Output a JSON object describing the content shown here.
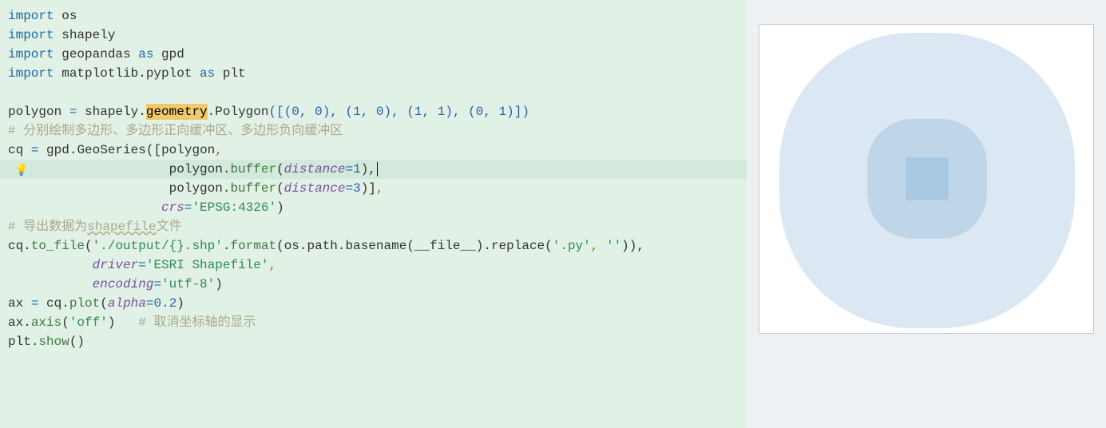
{
  "code": {
    "l1_import": "import",
    "l1_os": " os",
    "l2_import": "import",
    "l2_shapely": " shapely",
    "l3_import": "import",
    "l3_geopandas": " geopandas ",
    "l3_as": "as",
    "l3_gpd": " gpd",
    "l4_import": "import",
    "l4_mpl": " matplotlib.pyplot ",
    "l4_as": "as",
    "l4_plt": " plt",
    "l6_polygon": "polygon ",
    "l6_eq": "=",
    "l6_shapely": " shapely",
    "l6_dot1": ".",
    "l6_geometry": "geometry",
    "l6_dot2": ".",
    "l6_Polygon": "Polygon",
    "l6_args": "([(0, 0), (1, 0), (1, 1), (0, 1)])",
    "l7_comment": "# 分别绘制多边形、多边形正向缓冲区、多边形负向缓冲区",
    "l8_cq": "cq ",
    "l8_eq": "=",
    "l8_gpd": " gpd",
    "l8_dot": ".",
    "l8_GeoSeries": "GeoSeries",
    "l8_open": "([polygon",
    "l8_comma": ",",
    "l9_indent": "                     polygon",
    "l9_dot": ".",
    "l9_buffer": "buffer",
    "l9_open": "(",
    "l9_distance": "distance",
    "l9_eq": "=",
    "l9_one": "1",
    "l9_close": "),",
    "l10_indent": "                     polygon",
    "l10_dot": ".",
    "l10_buffer": "buffer",
    "l10_open": "(",
    "l10_distance": "distance",
    "l10_eq": "=",
    "l10_three": "3",
    "l10_close": ")]",
    "l10_comma": ",",
    "l11_indent": "                    ",
    "l11_crs": "crs",
    "l11_eq": "=",
    "l11_str": "'EPSG:4326'",
    "l11_close": ")",
    "l12_comment": "# 导出数据为",
    "l12_shapefile": "shapefile",
    "l12_comment2": "文件",
    "l13_cq": "cq",
    "l13_dot": ".",
    "l13_tofile": "to_file",
    "l13_open": "(",
    "l13_str1": "'./output/{}.shp'",
    "l13_dot2": ".",
    "l13_format": "format",
    "l13_open2": "(os.path.basename(__file__).replace(",
    "l13_py": "'.py'",
    "l13_comma": ", ",
    "l13_empty": "''",
    "l13_close": ")),",
    "l14_indent": "           ",
    "l14_driver": "driver",
    "l14_eq": "=",
    "l14_str": "'ESRI Shapefile'",
    "l14_comma": ",",
    "l15_indent": "           ",
    "l15_encoding": "encoding",
    "l15_eq": "=",
    "l15_str": "'utf-8'",
    "l15_close": ")",
    "l16_ax": "ax ",
    "l16_eq": "=",
    "l16_cq": " cq",
    "l16_dot": ".",
    "l16_plot": "plot",
    "l16_open": "(",
    "l16_alpha": "alpha",
    "l16_eq2": "=",
    "l16_val": "0.2",
    "l16_close": ")",
    "l17_ax": "ax",
    "l17_dot": ".",
    "l17_axis": "axis",
    "l17_open": "(",
    "l17_off": "'off'",
    "l17_close": ")",
    "l17_comment": "   # 取消坐标轴的显示",
    "l18_plt": "plt",
    "l18_dot": ".",
    "l18_show": "show",
    "l18_parens": "()"
  },
  "icons": {
    "bulb": "💡",
    "fold": "⌄"
  }
}
